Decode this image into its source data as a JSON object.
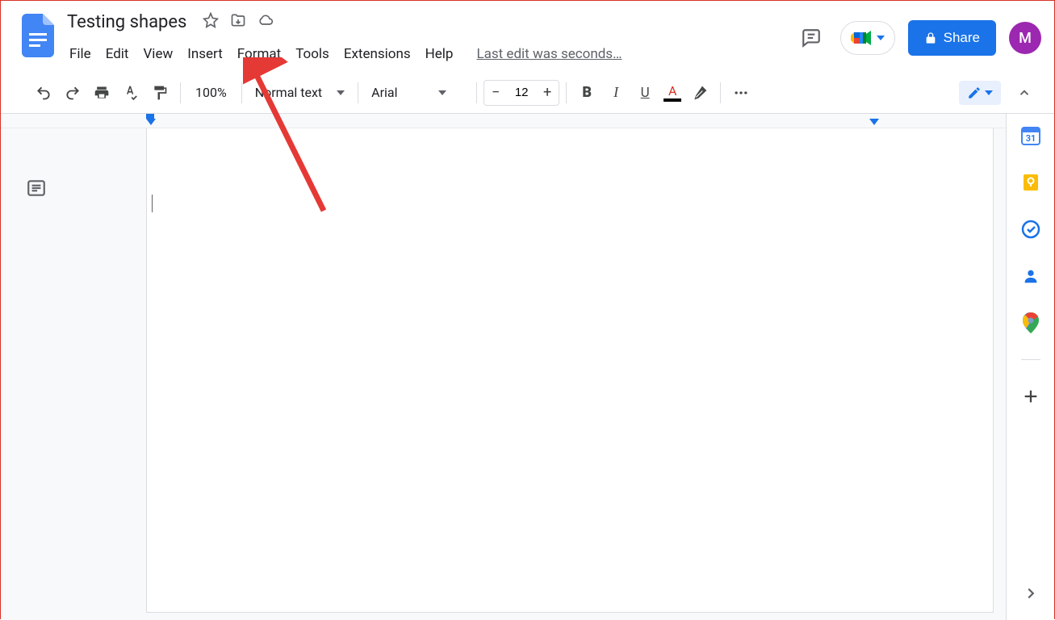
{
  "doc": {
    "title": "Testing shapes"
  },
  "menus": {
    "file": "File",
    "edit": "Edit",
    "view": "View",
    "insert": "Insert",
    "format": "Format",
    "tools": "Tools",
    "extensions": "Extensions",
    "help": "Help"
  },
  "last_edit": "Last edit was seconds…",
  "share": {
    "label": "Share"
  },
  "avatar": {
    "initial": "M"
  },
  "toolbar": {
    "zoom": "100%",
    "style": "Normal text",
    "font": "Arial",
    "font_size": "12"
  },
  "sidepanel": {
    "calendar_day": "31"
  }
}
